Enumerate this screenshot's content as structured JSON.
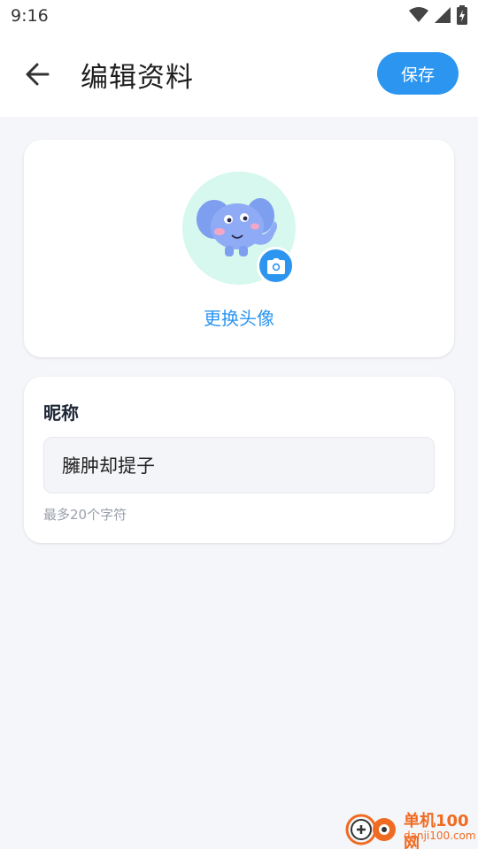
{
  "status_bar": {
    "time": "9:16",
    "icons": [
      "wifi-icon",
      "signal-icon",
      "battery-icon"
    ]
  },
  "app_bar": {
    "title": "编辑资料",
    "back_icon": "arrow-left-icon",
    "save_label": "保存"
  },
  "avatar_section": {
    "change_label": "更换头像",
    "camera_icon": "camera-icon"
  },
  "nickname_section": {
    "label": "昵称",
    "value": "臃肿却提子",
    "hint": "最多20个字符"
  },
  "watermark": {
    "title": "单机100网",
    "url": "danji100.com"
  },
  "colors": {
    "accent": "#2b95f0",
    "avatar_bg": "#d7f8ee",
    "page_bg": "#f5f6fa",
    "watermark": "#ef6b21"
  }
}
